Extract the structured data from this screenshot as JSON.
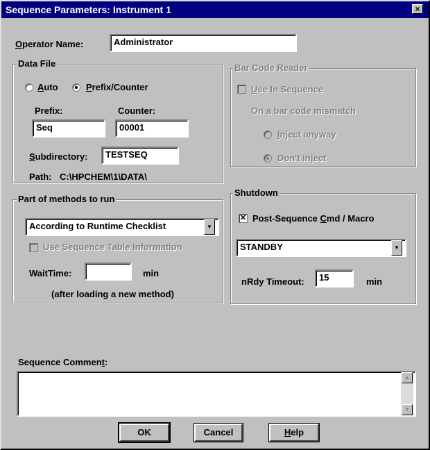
{
  "window": {
    "title": "Sequence Parameters: Instrument 1",
    "close_glyph": "×"
  },
  "operator": {
    "label_u": "O",
    "label_rest": "perator Name:",
    "value": "Administrator"
  },
  "data_file": {
    "legend": "Data File",
    "auto_u": "A",
    "auto_rest": "uto",
    "prefix_counter_u": "P",
    "prefix_counter_rest": "refix/Counter",
    "selected": "prefix_counter",
    "prefix_label": "Prefix:",
    "prefix_value": "Seq",
    "counter_label": "Counter:",
    "counter_value": "00001",
    "subdir_u": "S",
    "subdir_rest": "ubdirectory:",
    "subdir_value": "TESTSEQ",
    "path_label": "Path:",
    "path_value": "C:\\HPCHEM\\1\\DATA\\"
  },
  "barcode": {
    "legend": "Bar Code Reader",
    "use_u": "U",
    "use_rest": "se In Sequence",
    "mismatch_label": "On a bar code mismatch",
    "inject_u": "I",
    "inject_rest": "nject anyway",
    "dont_u": "D",
    "dont_rest": "on't inject"
  },
  "methods": {
    "legend": "Part of methods to run",
    "dropdown_value": "According to Runtime Checklist",
    "use_table_pre": "Use Se",
    "use_table_u": "q",
    "use_table_post": "uence Table Information",
    "waittime_label": "WaitTime:",
    "waittime_value": "",
    "waittime_unit": "min",
    "note": "(after loading a new method)"
  },
  "shutdown": {
    "legend": "Shutdown",
    "post_seq_pre": "Post-Sequence ",
    "post_seq_u": "C",
    "post_seq_post": "md / Macro",
    "post_seq_checked": true,
    "macro_value": "STANDBY",
    "nrdy_label": "nRdy Timeout:",
    "nrdy_value": "15",
    "nrdy_unit": "min"
  },
  "comment": {
    "label_pre": "Sequence Commen",
    "label_u": "t",
    "label_post": ":",
    "value": ""
  },
  "buttons": {
    "ok": "OK",
    "cancel": "Cancel",
    "help_u": "H",
    "help_rest": "elp"
  },
  "icons": {
    "dropdown": "▼",
    "up": "▲",
    "down": "▼",
    "check": "✕"
  }
}
